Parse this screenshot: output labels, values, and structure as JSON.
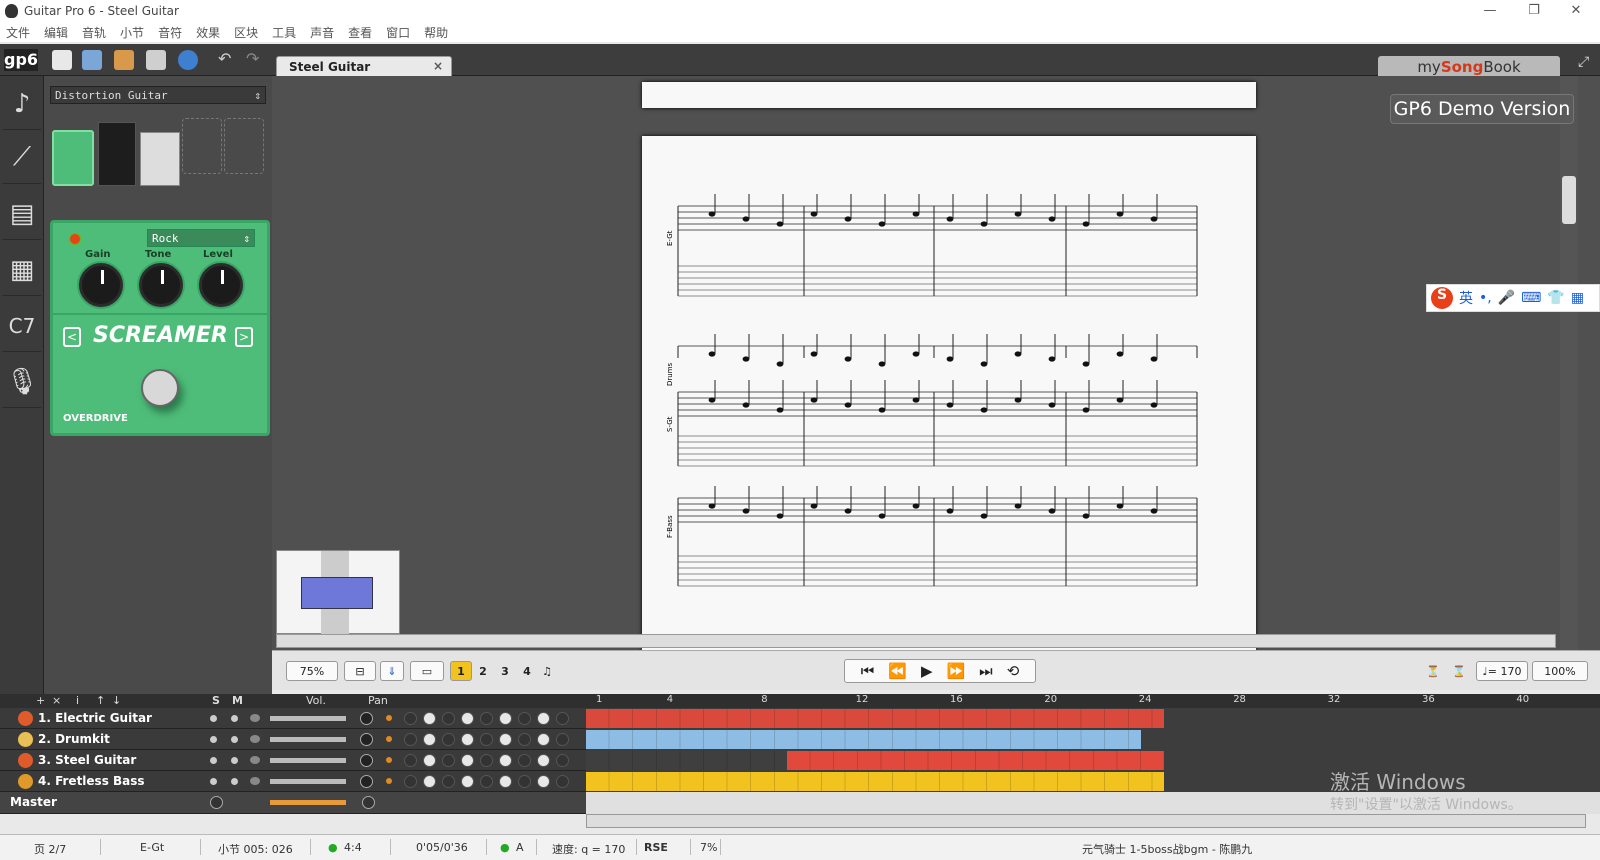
{
  "window": {
    "title": "Guitar Pro 6 - Steel Guitar",
    "min": "—",
    "restore": "❐",
    "close": "✕"
  },
  "menu": [
    "文件",
    "编辑",
    "音轨",
    "小节",
    "音符",
    "效果",
    "区块",
    "工具",
    "声音",
    "查看",
    "窗口",
    "帮助"
  ],
  "toolbar": {
    "logo": "gp6"
  },
  "tab": {
    "label": "Steel Guitar",
    "close": "×"
  },
  "songbook": {
    "prefix": "my",
    "brand": "Song",
    "suffix": "Book"
  },
  "demo_badge": "GP6 Demo Version",
  "sidebar_icons": [
    "note-icon",
    "guitar-icon",
    "mixer-icon",
    "rack-icon",
    "chord-icon",
    "mic-icon"
  ],
  "chord_glyph": "C7",
  "effects": {
    "preset": "Distortion Guitar",
    "pedal": {
      "mode": "Rock",
      "knobs": [
        {
          "label": "Gain"
        },
        {
          "label": "Tone"
        },
        {
          "label": "Level"
        }
      ],
      "name": "SCREAMER",
      "type": "OVERDRIVE",
      "prev": "<",
      "next": ">"
    }
  },
  "score": {
    "staves": [
      {
        "label": "E-Gt"
      },
      {
        "label": "Drums"
      },
      {
        "label": "S-Gt"
      },
      {
        "label": "F-Bass"
      }
    ]
  },
  "bottom": {
    "zoom": "75%",
    "voices": [
      "1",
      "2",
      "3",
      "4"
    ],
    "tempo": "♩= 170",
    "speed": "100%"
  },
  "track_header": {
    "s": "S",
    "m": "M",
    "vol": "Vol.",
    "pan": "Pan"
  },
  "ruler": [
    "1",
    "4",
    "8",
    "12",
    "16",
    "20",
    "24",
    "28",
    "32",
    "36",
    "40"
  ],
  "tracks": [
    {
      "name": "1. Electric Guitar",
      "color": "#e0483a",
      "icon": "#e05a2a",
      "bars": [
        {
          "start": 0,
          "end": 24.5,
          "color": "#d94a3c"
        }
      ]
    },
    {
      "name": "2. Drumkit",
      "color": "#7ab4e0",
      "icon": "#e8c055",
      "bars": [
        {
          "start": 0,
          "end": 23.5,
          "color": "#8dbde4"
        }
      ]
    },
    {
      "name": "3. Steel Guitar",
      "color": "#e0483a",
      "icon": "#e05a2a",
      "bars": [
        {
          "start": 0,
          "end": 8.5,
          "color": "#3f3f3f"
        },
        {
          "start": 8.5,
          "end": 24.5,
          "color": "#e0493b"
        }
      ]
    },
    {
      "name": "4. Fretless Bass",
      "color": "#f0c030",
      "icon": "#e09a2a",
      "bars": [
        {
          "start": 0,
          "end": 24.5,
          "color": "#f2c21e"
        }
      ]
    }
  ],
  "master": {
    "label": "Master"
  },
  "status": {
    "page": "页 2/7",
    "track": "E-Gt",
    "bar": "小节 005:  026",
    "sig": "4:4",
    "time": "0'05/0'36",
    "key": "A",
    "tempo": "速度:  q = 170",
    "rse": "RSE",
    "cpu": "7%",
    "song": "元气骑士 1-5boss战bgm - 陈鹏九"
  },
  "ime": {
    "logo": "S",
    "lang": "英",
    "punct": "•,"
  },
  "activate": {
    "line1": "激活 Windows",
    "line2": "转到\"设置\"以激活 Windows。"
  }
}
